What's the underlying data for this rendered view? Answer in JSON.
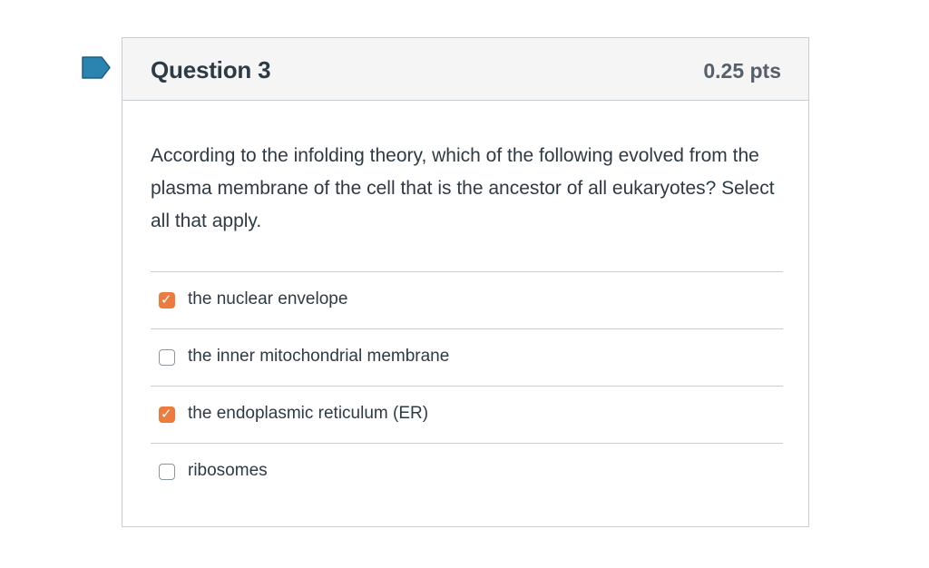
{
  "question": {
    "title": "Question 3",
    "points": "0.25 pts",
    "text": "According to the infolding theory, which of the following evolved from the plasma membrane of the cell that is the ancestor of all eukaryotes?  Select all that apply."
  },
  "flag": {
    "icon": "bookmark-flag-icon",
    "color": "#2b84b0"
  },
  "answers": [
    {
      "label": "the nuclear envelope",
      "checked": true
    },
    {
      "label": "the inner mitochondrial membrane",
      "checked": false
    },
    {
      "label": "the endoplasmic reticulum (ER)",
      "checked": true
    },
    {
      "label": "ribosomes",
      "checked": false
    }
  ],
  "colors": {
    "checked": "#ec7b3d",
    "header_bg": "#f5f5f5",
    "border": "#c7cdd1",
    "text": "#2d3b45"
  }
}
